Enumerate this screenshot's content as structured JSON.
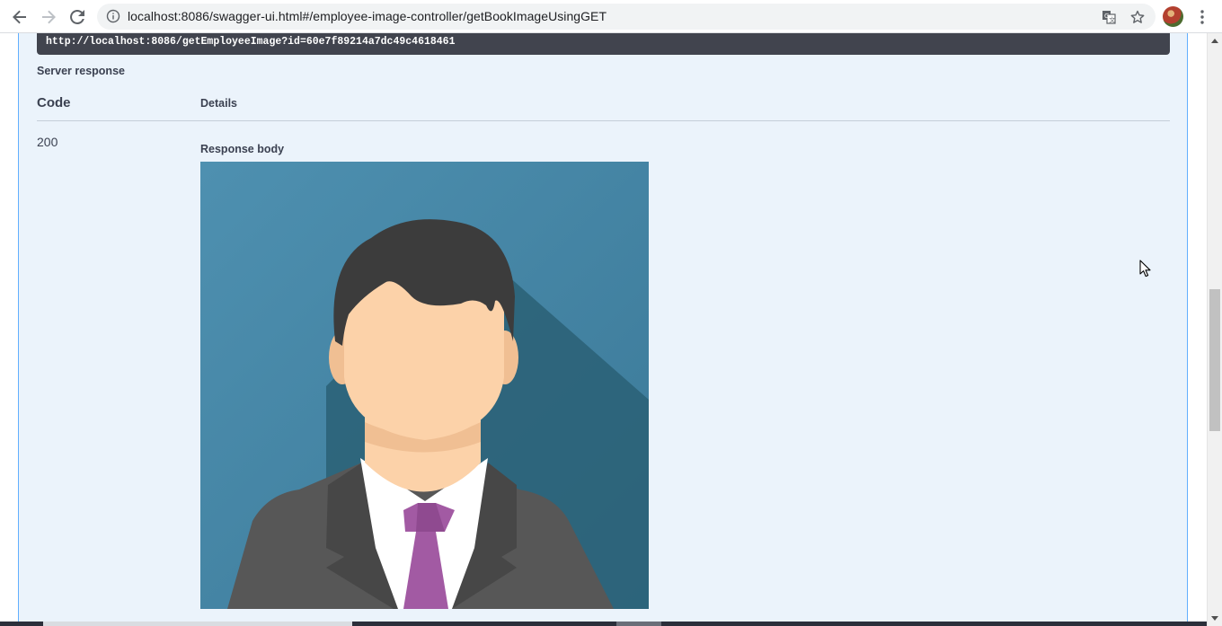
{
  "browser": {
    "url": "localhost:8086/swagger-ui.html#/employee-image-controller/getBookImageUsingGET",
    "icons": {
      "back": "arrow-left-icon",
      "forward": "arrow-right-icon",
      "reload": "reload-icon",
      "info": "info-icon",
      "translate": "translate-icon",
      "bookmark": "star-icon",
      "menu": "kebab-menu-icon"
    }
  },
  "response": {
    "request_url": "http://localhost:8086/getEmployeeImage?id=60e7f89214a7dc49c4618461",
    "server_response_label": "Server response",
    "code_header": "Code",
    "details_header": "Details",
    "status_code": "200",
    "response_body_label": "Response body",
    "image": "employee-avatar-image"
  },
  "colors": {
    "opblock_bg": "#ebf3fb",
    "opblock_border": "#61affe",
    "url_box_bg": "#41444e",
    "text": "#3b4151",
    "avatar_bg": "#4a8aaa",
    "avatar_shadow": "#2a6075",
    "tie": "#a25aa3",
    "suit": "#555555",
    "skin": "#fcd2a9",
    "hair": "#3c3c3c"
  }
}
